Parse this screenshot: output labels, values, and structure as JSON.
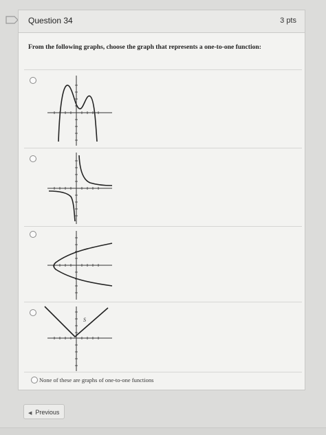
{
  "question": {
    "title": "Question 34",
    "points": "3 pts",
    "text": "From the following graphs, choose the graph that represents a one-to-one function:"
  },
  "options": [
    {
      "graph_icon": "polynomial-graph",
      "selected": false
    },
    {
      "graph_icon": "reciprocal-graph",
      "selected": false
    },
    {
      "graph_icon": "sideways-parabola-graph",
      "selected": false
    },
    {
      "graph_icon": "absolute-value-graph",
      "selected": false,
      "annotation": "S"
    }
  ],
  "none_option": {
    "label": "None of these are graphs of one-to-one functions",
    "selected": false
  },
  "nav": {
    "previous_label": "Previous",
    "previous_icon": "left-arrow-icon"
  },
  "colors": {
    "background": "#dcdcda",
    "card": "#f3f3f1",
    "header": "#e9e9e7"
  }
}
